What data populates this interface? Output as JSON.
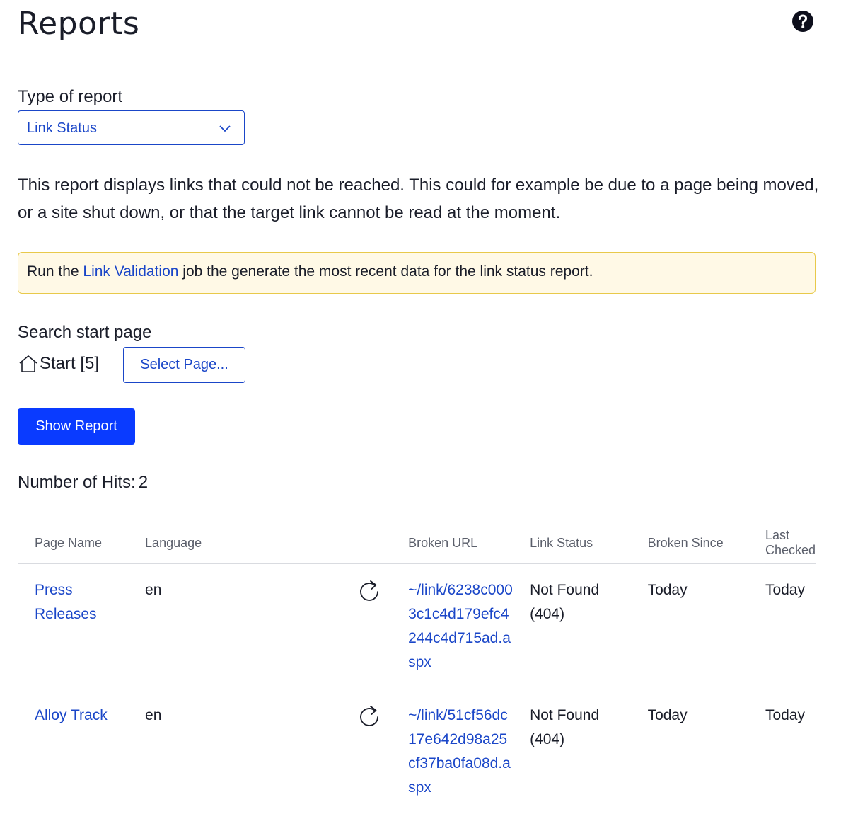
{
  "page": {
    "title": "Reports"
  },
  "report_type": {
    "label": "Type of report",
    "selected": "Link Status"
  },
  "description": "This report displays links that could not be reached. This could for example be due to a page being moved, or a site shut down, or that the target link cannot be read at the moment.",
  "notice": {
    "prefix": "Run the ",
    "link_text": "Link Validation",
    "suffix": " job the generate the most recent data for the link status report."
  },
  "search": {
    "label": "Search start page",
    "start_page": "Start [5]",
    "select_button": "Select Page..."
  },
  "show_report_button": "Show Report",
  "hits": {
    "label": "Number of Hits:",
    "count": "2"
  },
  "table": {
    "headers": {
      "page_name": "Page Name",
      "language": "Language",
      "refresh": "",
      "broken_url": "Broken URL",
      "link_status": "Link Status",
      "broken_since": "Broken Since",
      "last_checked": "Last Checked"
    },
    "rows": [
      {
        "page_name": "Press Releases",
        "language": "en",
        "broken_url": "~/link/6238c0003c1c4d179efc4244c4d715ad.aspx",
        "link_status": "Not Found (404)",
        "broken_since": "Today",
        "last_checked": "Today"
      },
      {
        "page_name": "Alloy Track",
        "language": "en",
        "broken_url": "~/link/51cf56dc17e642d98a25cf37ba0fa08d.aspx",
        "link_status": "Not Found (404)",
        "broken_since": "Today",
        "last_checked": "Today"
      }
    ]
  },
  "icons": {
    "help": "question-circle-icon",
    "dropdown": "chevron-down-icon",
    "home": "home-icon",
    "refresh": "refresh-icon"
  },
  "colors": {
    "accent": "#1a46c8",
    "primary_button": "#0a3bff",
    "notice_background": "#fff9e6",
    "notice_border": "#e8c94a"
  }
}
